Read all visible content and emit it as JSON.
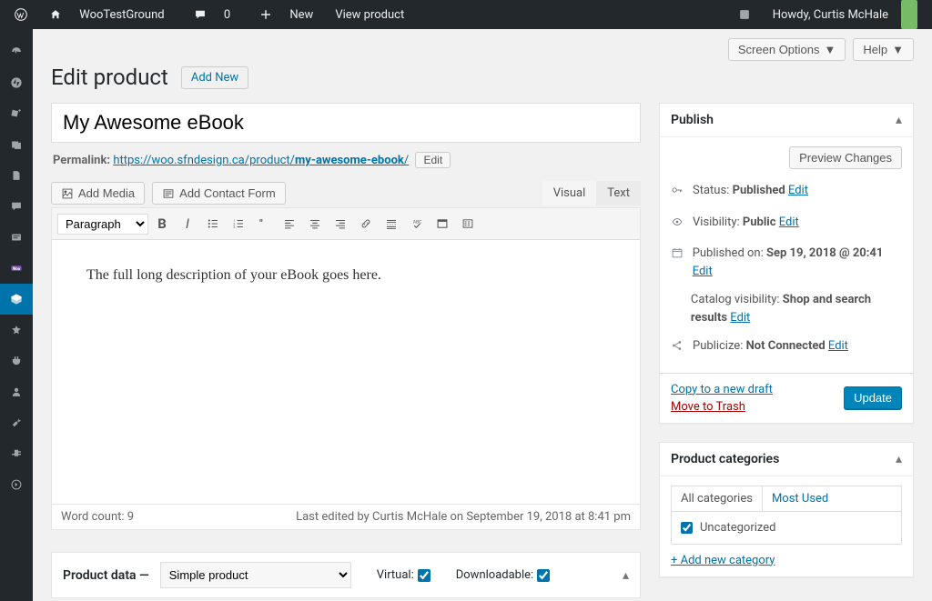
{
  "adminbar": {
    "site_name": "WooTestGround",
    "comments_count": "0",
    "new_label": "New",
    "view_label": "View product",
    "howdy": "Howdy, Curtis McHale"
  },
  "header": {
    "screen_options": "Screen Options",
    "help": "Help",
    "title": "Edit product",
    "add_new": "Add New"
  },
  "product": {
    "title": "My Awesome eBook",
    "permalink_label": "Permalink:",
    "permalink_base": "https://woo.sfndesign.ca/product/",
    "permalink_slug": "my-awesome-ebook",
    "permalink_tail": "/",
    "edit": "Edit"
  },
  "editor": {
    "add_media": "Add Media",
    "add_contact": "Add Contact Form",
    "tab_visual": "Visual",
    "tab_text": "Text",
    "paragraph": "Paragraph",
    "content": "The full long description of your eBook goes here.",
    "word_text": "Word count: 9",
    "last_edit": "Last edited by Curtis McHale on September 19, 2018 at 8:41 pm"
  },
  "publish": {
    "title": "Publish",
    "preview": "Preview Changes",
    "status_label": "Status:",
    "status_value": "Published",
    "visibility_label": "Visibility:",
    "visibility_value": "Public",
    "published_label": "Published on:",
    "published_value": "Sep 19, 2018 @ 20:41",
    "catalog_label": "Catalog visibility:",
    "catalog_value": "Shop and search results",
    "publicize_label": "Publicize:",
    "publicize_value": "Not Connected",
    "edit": "Edit",
    "copy": "Copy to a new draft",
    "trash": "Move to Trash",
    "update": "Update"
  },
  "categories": {
    "title": "Product categories",
    "tab_all": "All categories",
    "tab_used": "Most Used",
    "uncategorized": "Uncategorized",
    "add_new": "+ Add new category"
  },
  "product_data": {
    "title": "Product data —",
    "type": "Simple product",
    "virtual": "Virtual:",
    "downloadable": "Downloadable:"
  }
}
